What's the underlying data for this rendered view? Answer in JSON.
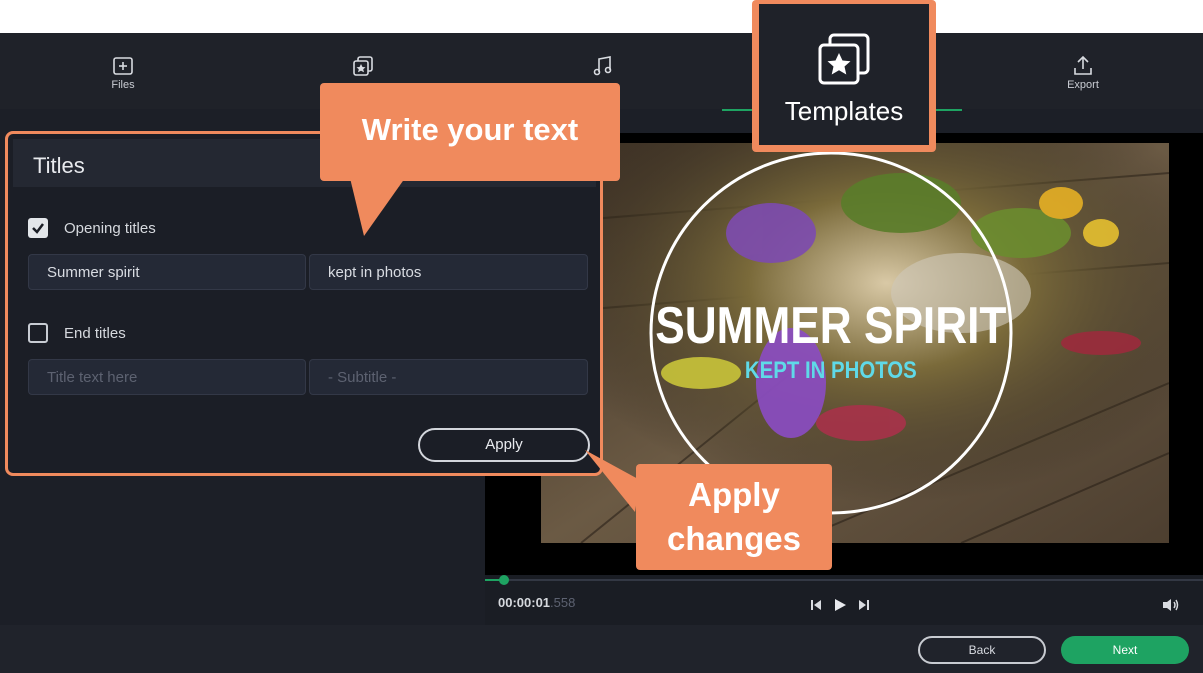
{
  "toolbar": {
    "tabs": [
      {
        "label": "Files",
        "icon": "add-file-icon"
      },
      {
        "label": "",
        "icon": "filters-icon"
      },
      {
        "label": "",
        "icon": "music-note-icon"
      },
      {
        "label": "Templates",
        "icon": "star-frames-icon"
      },
      {
        "label": "Export",
        "icon": "export-upload-icon"
      }
    ],
    "active_tab": "Templates"
  },
  "titles_panel": {
    "title": "Titles",
    "opening": {
      "label": "Opening titles",
      "checked": true,
      "title_value": "Summer spirit",
      "subtitle_value": "kept in photos"
    },
    "end": {
      "label": "End titles",
      "checked": false,
      "title_placeholder": "Title text here",
      "subtitle_placeholder": "- Subtitle -"
    },
    "apply_label": "Apply"
  },
  "preview": {
    "overlay_title": "SUMMER SPIRIT",
    "overlay_subtitle": "KEPT IN PHOTOS",
    "timecode_main": "00:00:01",
    "timecode_ms": ".558",
    "progress": 0.03
  },
  "footer": {
    "back_label": "Back",
    "next_label": "Next"
  },
  "callouts": {
    "write_text": "Write your text",
    "templates": "Templates",
    "apply_line1": "Apply",
    "apply_line2": "changes"
  },
  "colors": {
    "accent": "#f08a5d",
    "green": "#1ea362",
    "overlay_sub": "#5fd9e8"
  }
}
